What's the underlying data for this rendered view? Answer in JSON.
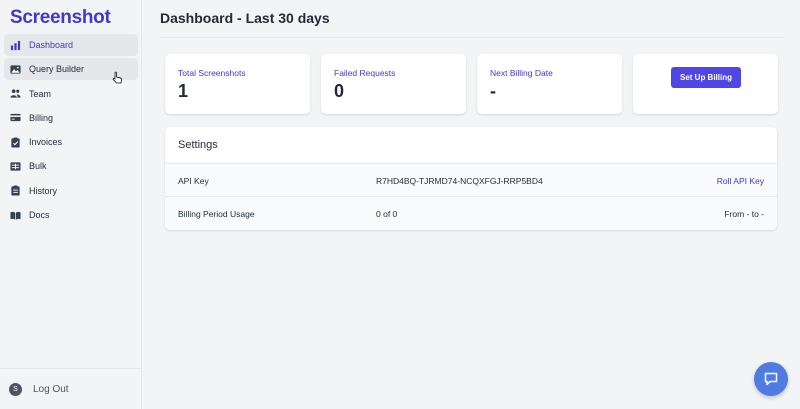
{
  "brand": {
    "logo_text": "Screenshot",
    "color": "#4338ca"
  },
  "sidebar": {
    "items": [
      {
        "label": "Dashboard",
        "icon": "chart-bar-icon"
      },
      {
        "label": "Query Builder",
        "icon": "image-icon"
      },
      {
        "label": "Team",
        "icon": "users-icon"
      },
      {
        "label": "Billing",
        "icon": "credit-card-icon"
      },
      {
        "label": "Invoices",
        "icon": "clipboard-check-icon"
      },
      {
        "label": "Bulk",
        "icon": "table-icon"
      },
      {
        "label": "History",
        "icon": "clipboard-list-icon"
      },
      {
        "label": "Docs",
        "icon": "book-open-icon"
      }
    ],
    "active_item": "Dashboard",
    "hovered_item": "Query Builder",
    "footer": {
      "avatar_initial": "S",
      "logout_label": "Log Out"
    }
  },
  "main": {
    "title": "Dashboard - Last 30 days",
    "stats": [
      {
        "label": "Total Screenshots",
        "value": "1"
      },
      {
        "label": "Failed Requests",
        "value": "0"
      },
      {
        "label": "Next Billing Date",
        "value": "-"
      }
    ],
    "billing_button_label": "Set Up Billing",
    "settings": {
      "title": "Settings",
      "rows": [
        {
          "label": "API Key",
          "value": "R7HD4BQ-TJRMD74-NCQXFGJ-RRP5BD4",
          "action": "Roll API Key"
        },
        {
          "label": "Billing Period Usage",
          "value": "0 of 0",
          "action": "From - to -"
        }
      ]
    }
  },
  "chat": {
    "icon": "chat-bubble-icon",
    "color": "#4f7be3"
  }
}
